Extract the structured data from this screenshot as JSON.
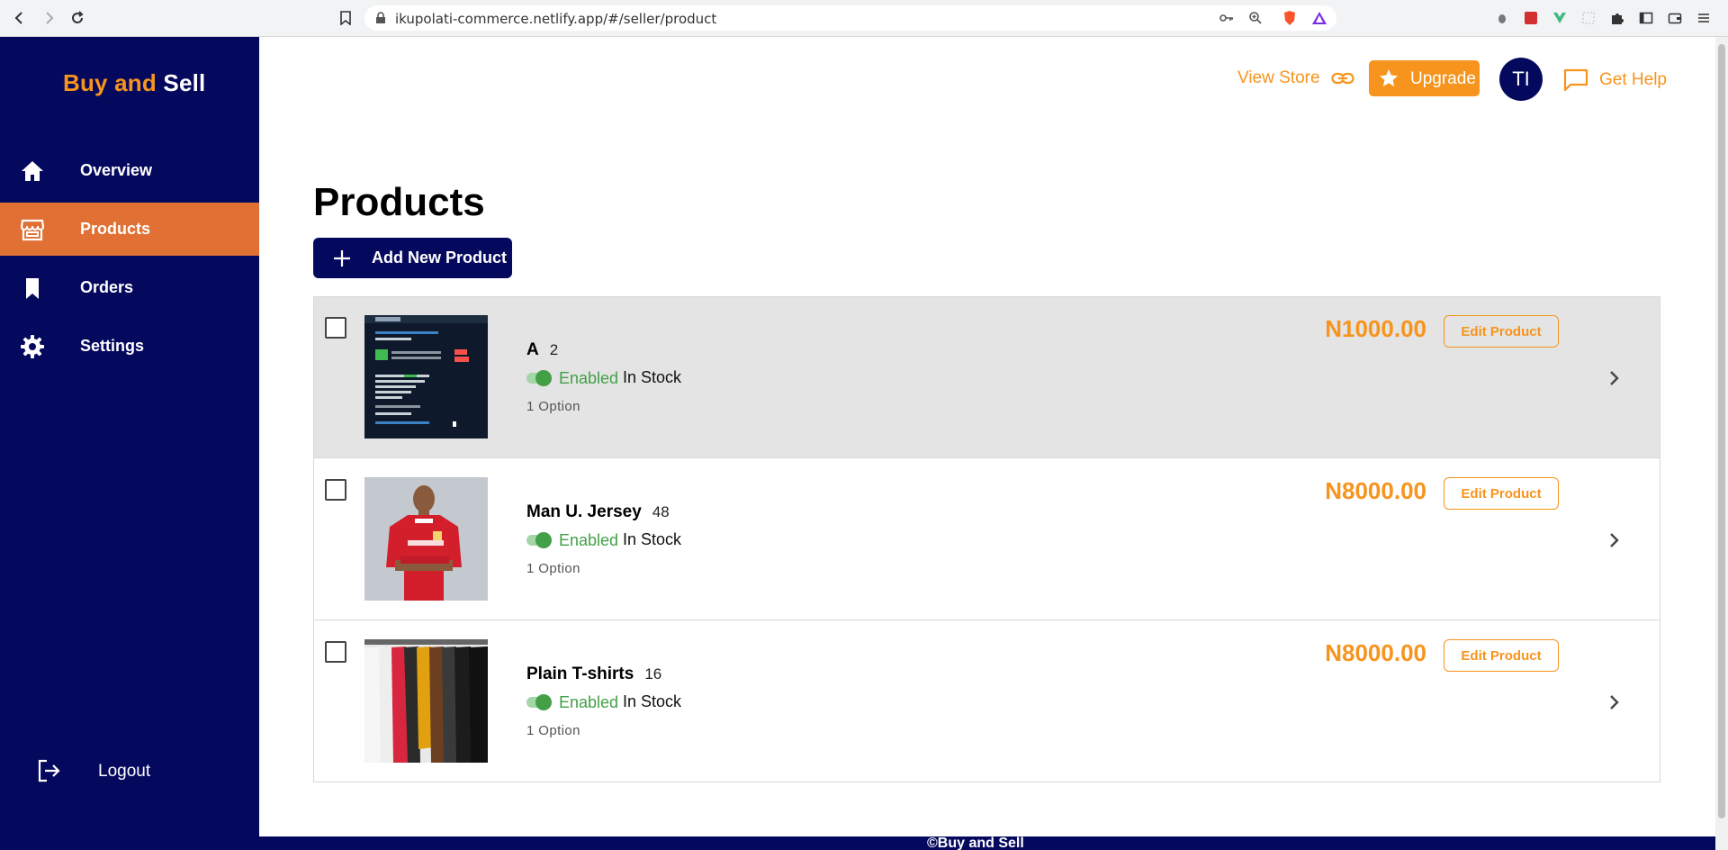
{
  "browser": {
    "url": "ikupolati-commerce.netlify.app/#/seller/product"
  },
  "sidebar": {
    "brand_part1": "Buy and",
    "brand_part2": "Sell",
    "items": [
      {
        "label": "Overview",
        "icon": "home-icon"
      },
      {
        "label": "Products",
        "icon": "store-icon"
      },
      {
        "label": "Orders",
        "icon": "bookmark-icon"
      },
      {
        "label": "Settings",
        "icon": "gear-icon"
      }
    ],
    "logout_label": "Logout"
  },
  "header": {
    "view_store": "View Store",
    "upgrade": "Upgrade",
    "avatar_initials": "TI",
    "get_help": "Get Help"
  },
  "main": {
    "title": "Products",
    "add_button": "Add New Product",
    "products": [
      {
        "name": "A",
        "qty": "2",
        "status": "Enabled",
        "stock": "In Stock",
        "options": "1 Option",
        "price": "N1000.00",
        "edit": "Edit Product"
      },
      {
        "name": "Man U. Jersey",
        "qty": "48",
        "status": "Enabled",
        "stock": "In Stock",
        "options": "1 Option",
        "price": "N8000.00",
        "edit": "Edit Product"
      },
      {
        "name": "Plain T-shirts",
        "qty": "16",
        "status": "Enabled",
        "stock": "In Stock",
        "options": "1 Option",
        "price": "N8000.00",
        "edit": "Edit Product"
      }
    ]
  },
  "footer": {
    "text": "©Buy and Sell"
  },
  "colors": {
    "navy": "#05095e",
    "accent": "#f7941d",
    "active_nav": "#e07033",
    "enabled_green": "#43a047"
  }
}
